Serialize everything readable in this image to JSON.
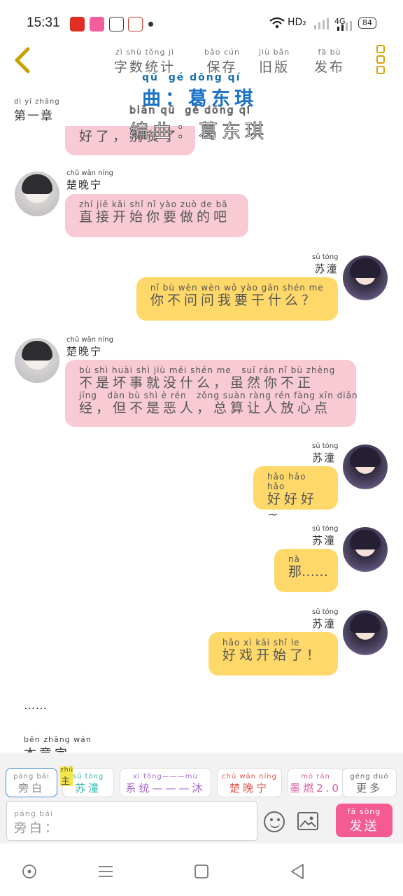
{
  "status": {
    "time": "15:31",
    "apps": [
      {
        "icon": "pinduoduo-app-icon",
        "color": "#e02e24"
      },
      {
        "icon": "pink-app-icon",
        "color": "#f25f9c"
      },
      {
        "icon": "paw-app-icon",
        "color": "#3f3f3f"
      },
      {
        "icon": "map-app-icon",
        "color": "#e03d2f"
      }
    ],
    "hd": "HD₂",
    "network": "4G",
    "battery": "84"
  },
  "header": {
    "actions": [
      {
        "pinyin": "zì shù tǒng jì",
        "label": "字数统计"
      },
      {
        "pinyin": "bǎo cún",
        "label": "保存"
      },
      {
        "pinyin": "jiù bǎn",
        "label": "旧版"
      },
      {
        "pinyin": "fā bù",
        "label": "发布"
      }
    ]
  },
  "chapter": {
    "pinyin": "dì yī zhāng",
    "label": "第一章"
  },
  "overlay": {
    "line1_pinyin": "qū  gé dōng qí",
    "line1": "曲：葛东琪",
    "line2_pinyin": "biān qū  gé dōng qí",
    "line2": "编曲：葛东琪"
  },
  "messages": [
    {
      "pinyin": "",
      "text": "好了，别贫了"
    },
    {
      "name_pinyin": "chǔ wǎn níng",
      "name": "楚晚宁",
      "pinyin": "zhí jiē kāi shǐ nǐ yào zuò de bā",
      "text": "直接开始你要做的吧"
    },
    {
      "name_pinyin": "sū tóng",
      "name": "苏潼",
      "pinyin": "nǐ bù wèn wèn wǒ yào gān shén me",
      "text": "你不问问我要干什么？"
    },
    {
      "name_pinyin": "chǔ wǎn níng",
      "name": "楚晚宁",
      "pinyin": "bù shì huài shì jiù méi shén me   suī rán nǐ bù zhèng",
      "text": "不是坏事就没什么，虽然你不正",
      "pinyin2": "jīng   dàn bù shì è rén   zǒng suàn ràng rén fàng xīn diǎn",
      "text2": "经，但不是恶人，总算让人放心点"
    },
    {
      "name_pinyin": "sū tóng",
      "name": "苏潼",
      "pinyin": "hǎo hǎo hǎo",
      "text": "好好好~"
    },
    {
      "name_pinyin": "sū tóng",
      "name": "苏潼",
      "pinyin": "nà",
      "text": "那……"
    },
    {
      "name_pinyin": "sū tóng",
      "name": "苏潼",
      "pinyin": "hǎo xì kāi shǐ le",
      "text": "好戏开始了！"
    }
  ],
  "narration": {
    "dots": "……",
    "end_pinyin": "běn zhāng wán",
    "end": "本章完"
  },
  "roles": [
    {
      "pinyin": "páng bái",
      "label": "旁白",
      "color": "#888888"
    },
    {
      "pinyin": "sū tóng",
      "label": "苏潼",
      "color": "#2bb8b0"
    },
    {
      "pinyin": "xì tǒng———mù",
      "label": "系统———沐",
      "color": "#a86ad0"
    },
    {
      "pinyin": "chǔ wǎn níng",
      "label": "楚晚宁",
      "color": "#e0544a"
    },
    {
      "pinyin": "mò rán",
      "label": "墨燃2.0",
      "color": "#d85fa0"
    },
    {
      "pinyin": "gēng duō",
      "label": "更多",
      "color": "#666666"
    }
  ],
  "badge": {
    "pinyin": "zhǔ",
    "label": "主"
  },
  "input": {
    "pinyin": "páng bái",
    "placeholder": "旁白："
  },
  "send": {
    "pinyin": "fā sòng",
    "label": "发送"
  }
}
